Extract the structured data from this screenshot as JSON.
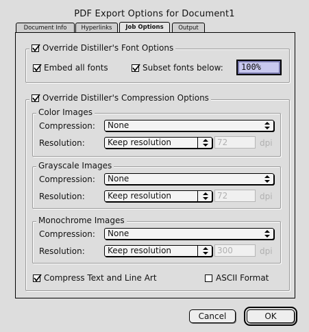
{
  "window": {
    "title": "PDF Export Options for Document1"
  },
  "tabs": [
    {
      "label": "Document Info"
    },
    {
      "label": "Hyperlinks"
    },
    {
      "label": "Job Options"
    },
    {
      "label": "Output"
    }
  ],
  "font_options": {
    "override_label": "Override Distiller's Font Options",
    "override_checked": true,
    "embed_label": "Embed all fonts",
    "embed_checked": true,
    "subset_label": "Subset fonts below:",
    "subset_checked": true,
    "subset_value": "100%"
  },
  "compression": {
    "override_label": "Override Distiller's Compression Options",
    "override_checked": true,
    "compression_label": "Compression:",
    "resolution_label": "Resolution:",
    "unit": "dpi",
    "color": {
      "heading": "Color Images",
      "compression": "None",
      "resolution": "Keep resolution",
      "dpi": "72"
    },
    "grayscale": {
      "heading": "Grayscale Images",
      "compression": "None",
      "resolution": "Keep resolution",
      "dpi": "72"
    },
    "monochrome": {
      "heading": "Monochrome Images",
      "compression": "None",
      "resolution": "Keep resolution",
      "dpi": "300"
    },
    "compress_text_label": "Compress Text and Line Art",
    "compress_text_checked": true,
    "ascii_label": "ASCII Format",
    "ascii_checked": false
  },
  "buttons": {
    "cancel": "Cancel",
    "ok": "OK"
  }
}
